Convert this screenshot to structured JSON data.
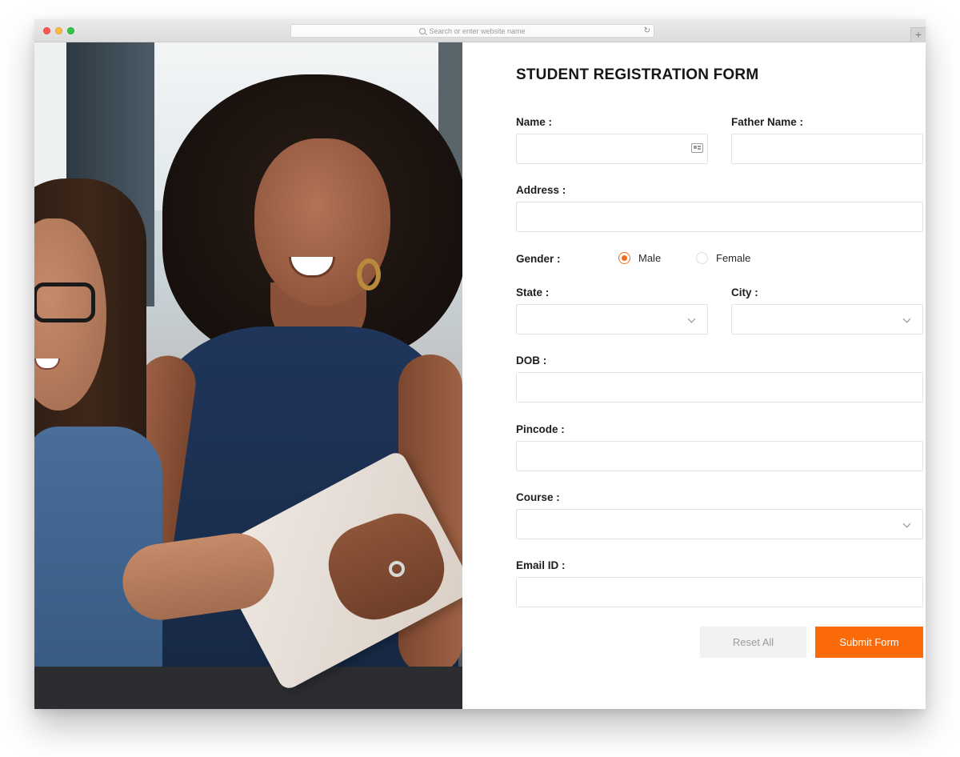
{
  "browser": {
    "url_placeholder": "Search or enter website name",
    "new_tab_label": "+"
  },
  "form": {
    "title": "STUDENT REGISTRATION FORM",
    "fields": {
      "name": {
        "label": "Name :",
        "value": ""
      },
      "father_name": {
        "label": "Father Name :",
        "value": ""
      },
      "address": {
        "label": "Address :",
        "value": ""
      },
      "gender": {
        "label": "Gender :",
        "options": [
          "Male",
          "Female"
        ],
        "selected": "Male"
      },
      "state": {
        "label": "State :",
        "value": ""
      },
      "city": {
        "label": "City :",
        "value": ""
      },
      "dob": {
        "label": "DOB :",
        "value": ""
      },
      "pincode": {
        "label": "Pincode :",
        "value": ""
      },
      "course": {
        "label": "Course :",
        "value": ""
      },
      "email": {
        "label": "Email ID :",
        "value": ""
      }
    },
    "buttons": {
      "reset_label": "Reset All",
      "submit_label": "Submit Form"
    }
  },
  "colors": {
    "accent": "#fb6a08",
    "radio_checked": "#f26b16",
    "field_border": "#e3e3e3"
  },
  "icons": {
    "name_field": "contact-card-icon",
    "selects": "chevron-down-icon",
    "reload": "reload-icon",
    "url_search": "search-icon"
  }
}
